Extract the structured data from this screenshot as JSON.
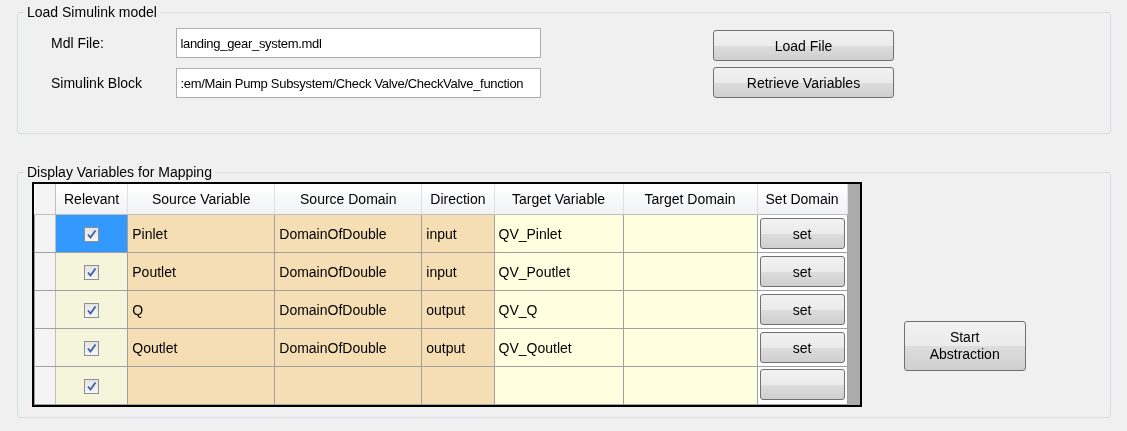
{
  "load_group": {
    "title": "Load Simulink model",
    "fields": [
      {
        "label": "Mdl File:",
        "value": "landing_gear_system.mdl"
      },
      {
        "label": "Simulink Block",
        "value": ":em/Main Pump Subsystem/Check Valve/CheckValve_function"
      }
    ],
    "buttons": [
      "Load File",
      "Retrieve Variables"
    ]
  },
  "mapping_group": {
    "title": "Display Variables for Mapping",
    "table": {
      "columns": [
        "Relevant",
        "Source Variable",
        "Source Domain",
        "Direction",
        "Target Variable",
        "Target Domain",
        "Set Domain"
      ],
      "rows": [
        {
          "selected": true,
          "relevant": true,
          "source_variable": "Pinlet",
          "source_domain": "DomainOfDouble",
          "direction": "input",
          "target_variable": "QV_Pinlet",
          "set_button": "set"
        },
        {
          "selected": false,
          "relevant": true,
          "source_variable": "Poutlet",
          "source_domain": "DomainOfDouble",
          "direction": "input",
          "target_variable": "QV_Poutlet",
          "set_button": "set"
        },
        {
          "selected": false,
          "relevant": true,
          "source_variable": "Q",
          "source_domain": "DomainOfDouble",
          "direction": "output",
          "target_variable": "QV_Q",
          "set_button": "set"
        },
        {
          "selected": false,
          "relevant": true,
          "source_variable": "Qoutlet",
          "source_domain": "DomainOfDouble",
          "direction": "output",
          "target_variable": "QV_Qoutlet",
          "set_button": "set"
        },
        {
          "selected": false,
          "relevant": true
        }
      ]
    },
    "start_button": {
      "lines": [
        "Start",
        "Abstraction"
      ]
    }
  }
}
